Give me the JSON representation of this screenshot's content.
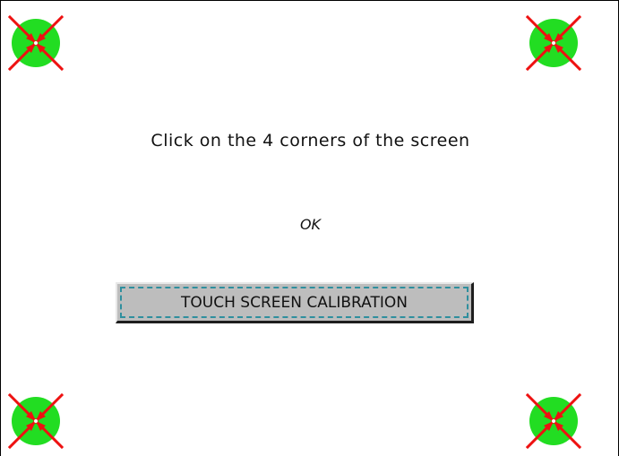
{
  "calibration": {
    "instruction": "Click on the 4 corners of the screen",
    "status": "OK",
    "button_label": "TOUCH SCREEN CALIBRATION",
    "target_icon": "calibration-target-icon",
    "colors": {
      "target_fill": "#22dd22",
      "arrow": "#ee1111",
      "button_face": "#bdbdbd",
      "focus_ring": "#2f8f9e"
    }
  }
}
